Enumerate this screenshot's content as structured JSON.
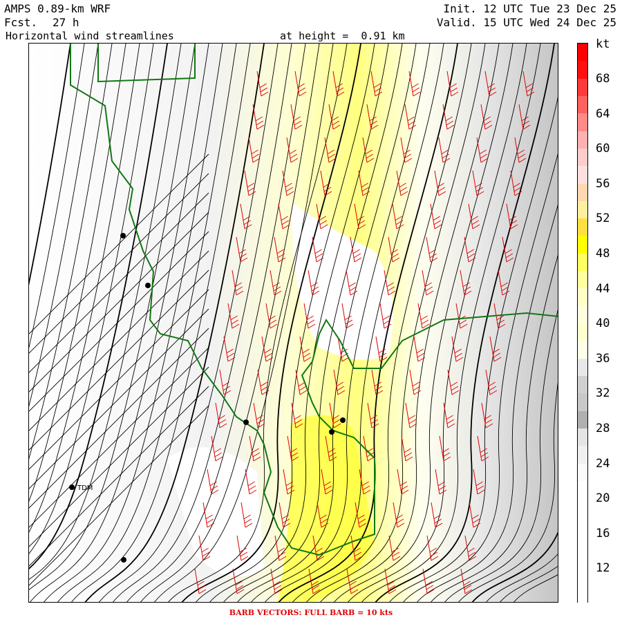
{
  "header": {
    "model": "AMPS 0.89-km WRF",
    "forecast_label": "Fcst.",
    "forecast_value": "27 h",
    "field": "Horizontal wind streamlines",
    "height_text": "at height =  0.91 km",
    "init": "Init. 12 UTC Tue 23 Dec 25",
    "valid": "Valid. 15 UTC Wed 24 Dec 25"
  },
  "colorbar": {
    "unit": "kt",
    "labels": [
      "68",
      "64",
      "60",
      "56",
      "52",
      "48",
      "44",
      "40",
      "36",
      "32",
      "28",
      "24",
      "20",
      "16",
      "12"
    ],
    "colors": [
      "#ff0000",
      "#ff1010",
      "#ff3a3a",
      "#ff6060",
      "#ff8a8a",
      "#ffb0b0",
      "#ffcccc",
      "#ffe0e0",
      "#ffd8b0",
      "#fff0a0",
      "#ffe040",
      "#ffff00",
      "#ffff60",
      "#ffffa0",
      "#ffffc8",
      "#ffffe0",
      "#ffffd0",
      "#ffffe8",
      "#e8e8e8",
      "#d0d0d0",
      "#c8c8c8",
      "#b0b0b0",
      "#e4e4e4",
      "#f0f0f0",
      "#fafafa",
      "#ffffff",
      "#ffffff",
      "#ffffff",
      "#ffffff",
      "#ffffff",
      "#ffffff",
      "#ffffff"
    ]
  },
  "stations": [
    {
      "label": ""
    },
    {
      "label": ""
    },
    {
      "label": ""
    },
    {
      "label": ""
    },
    {
      "label": ""
    },
    {
      "label": "TDM"
    },
    {
      "label": ""
    }
  ],
  "footer": "BARB VECTORS:  FULL BARB = 10 kts",
  "colors": {
    "streamline": "#000000",
    "coastline": "#117711",
    "barb": "#dd0000"
  }
}
